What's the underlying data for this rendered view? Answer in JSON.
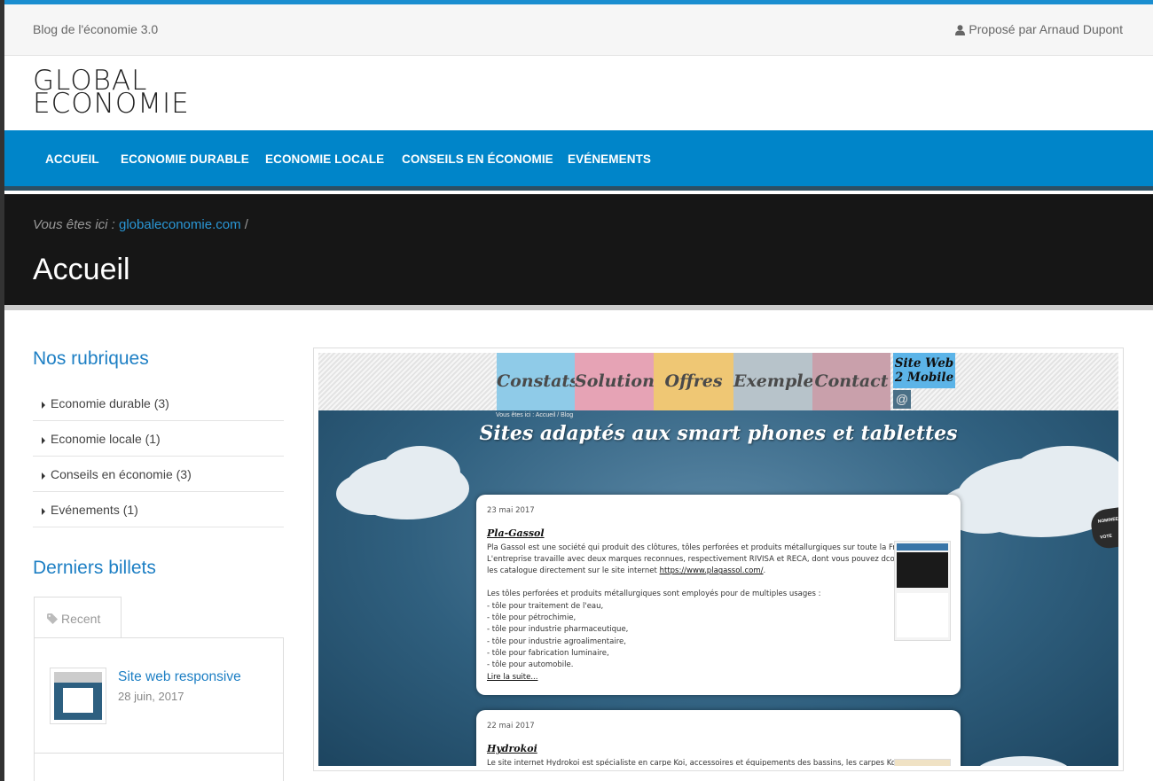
{
  "topbar": {
    "site_tag": "Blog de l'économie 3.0",
    "author": "Proposé par Arnaud Dupont"
  },
  "logo": {
    "line1": "GLOBAL",
    "line2": "ECONOMIE"
  },
  "nav": {
    "items": [
      "ACCUEIL",
      "ECONOMIE DURABLE",
      "ECONOMIE LOCALE",
      "CONSEILS EN ÉCONOMIE",
      "EVÉNEMENTS"
    ]
  },
  "hero": {
    "crumb_prefix": "Vous êtes ici :",
    "crumb_link": "globaleconomie.com",
    "crumb_sep": "/",
    "title": "Accueil"
  },
  "sidebar": {
    "rubriques_title": "Nos rubriques",
    "rubriques": [
      "Economie durable (3)",
      "Economie locale (1)",
      "Conseils en économie (3)",
      "Evénements (1)"
    ],
    "billets_title": "Derniers billets",
    "tab_label": "Recent",
    "recent_post": {
      "title": "Site web responsive",
      "date": "28 juin, 2017"
    }
  },
  "preview": {
    "tabs": [
      "Constats",
      "Solutions",
      "Offres",
      "Exemple",
      "Contact"
    ],
    "tab_colors": [
      "#8fcbe8",
      "#e6a3b5",
      "#efc774",
      "#b7c3ca",
      "#c9a0ab"
    ],
    "side_label_line1": "Site Web",
    "side_label_line2": "2 Mobile",
    "at_symbol": "@",
    "mini_crumb": "Vous êtes ici : Accueil / Blog",
    "headline": "Sites adaptés aux smart phones et tablettes",
    "ribbon_top": "NOMINEE",
    "ribbon_bottom": "VOTE",
    "post1": {
      "date": "23 mai 2017",
      "title": "Pla-Gassol",
      "line1": "Pla Gassol est une société qui produit des clôtures, tôles perforées et produits métallurgiques sur toute la France.",
      "line2": "L'entreprise travaille avec deux marques reconnues, respectivement RIVISA et RECA, dont vous pouvez dcouvrir",
      "line3_prefix": "les catalogue directement sur le site internet",
      "line3_link": "https://www.plagassol.com/",
      "line3_suffix": ".",
      "usages_intro": "Les tôles perforées et produits métallurgiques sont employés pour de multiples usages :",
      "usages": [
        "- tôle pour traitement de l'eau,",
        "- tôle pour pétrochimie,",
        "- tôle pour industrie pharmaceutique,",
        "- tôle pour industrie agroalimentaire,",
        "- tôle pour fabrication luminaire,",
        "- tôle pour automobile."
      ],
      "read_more": "Lire la suite..."
    },
    "post2": {
      "date": "22 mai 2017",
      "title": "Hydrokoi",
      "line1": "Le site internet Hydrokoi est spécialiste en carpe Koi, accessoires et équipements des bassins, les carpes Koï sont"
    }
  }
}
